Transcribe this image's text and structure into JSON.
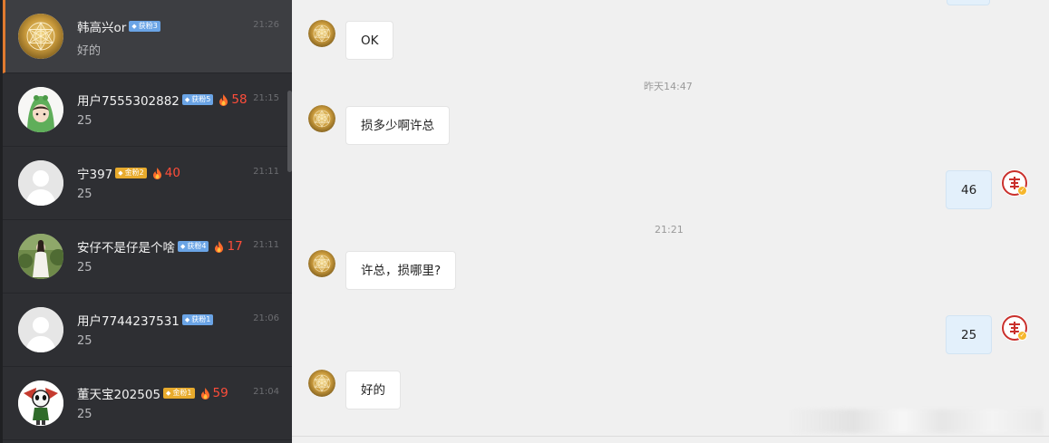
{
  "conversations": [
    {
      "name": "韩高兴or",
      "badge": "获粉3",
      "badge_color": "#6aa4e6",
      "fire": "",
      "time": "21:26",
      "preview": "好的",
      "avatar": "gold-emblem"
    },
    {
      "name": "用户7555302882",
      "badge": "获粉5",
      "badge_color": "#6aa4e6",
      "fire": "58",
      "time": "21:15",
      "preview": "25",
      "avatar": "green-hood-girl"
    },
    {
      "name": "宁397",
      "badge": "金粉2",
      "badge_color": "#e8ab2d",
      "fire": "40",
      "time": "21:11",
      "preview": "25",
      "avatar": "default-person"
    },
    {
      "name": "安仔不是仔是个啥",
      "badge": "获粉4",
      "badge_color": "#6aa4e6",
      "fire": "17",
      "time": "21:11",
      "preview": "25",
      "avatar": "photo-woman"
    },
    {
      "name": "用户7744237531",
      "badge": "获粉1",
      "badge_color": "#6aa4e6",
      "fire": "",
      "time": "21:06",
      "preview": "25",
      "avatar": "default-person"
    },
    {
      "name": "董天宝202505",
      "badge": "金粉1",
      "badge_color": "#e8ab2d",
      "fire": "59",
      "time": "21:04",
      "preview": "25",
      "avatar": "cartoon-character"
    }
  ],
  "chat": {
    "messages": [
      {
        "direction": "in",
        "text": "OK"
      },
      {
        "type": "timestamp",
        "text": "昨天14:47"
      },
      {
        "direction": "in",
        "text": "损多少啊许总"
      },
      {
        "direction": "out",
        "text": "46"
      },
      {
        "type": "timestamp",
        "text": "21:21"
      },
      {
        "direction": "in",
        "text": "许总，损哪里?"
      },
      {
        "direction": "out",
        "text": "25"
      },
      {
        "direction": "in",
        "text": "好的"
      }
    ]
  },
  "colors": {
    "sidebar_bg": "#2e2f33",
    "active_accent": "#e07a2f",
    "fire_red": "#ff4d3a",
    "outgoing_bubble": "#e3f0fb",
    "incoming_bubble": "#ffffff"
  }
}
